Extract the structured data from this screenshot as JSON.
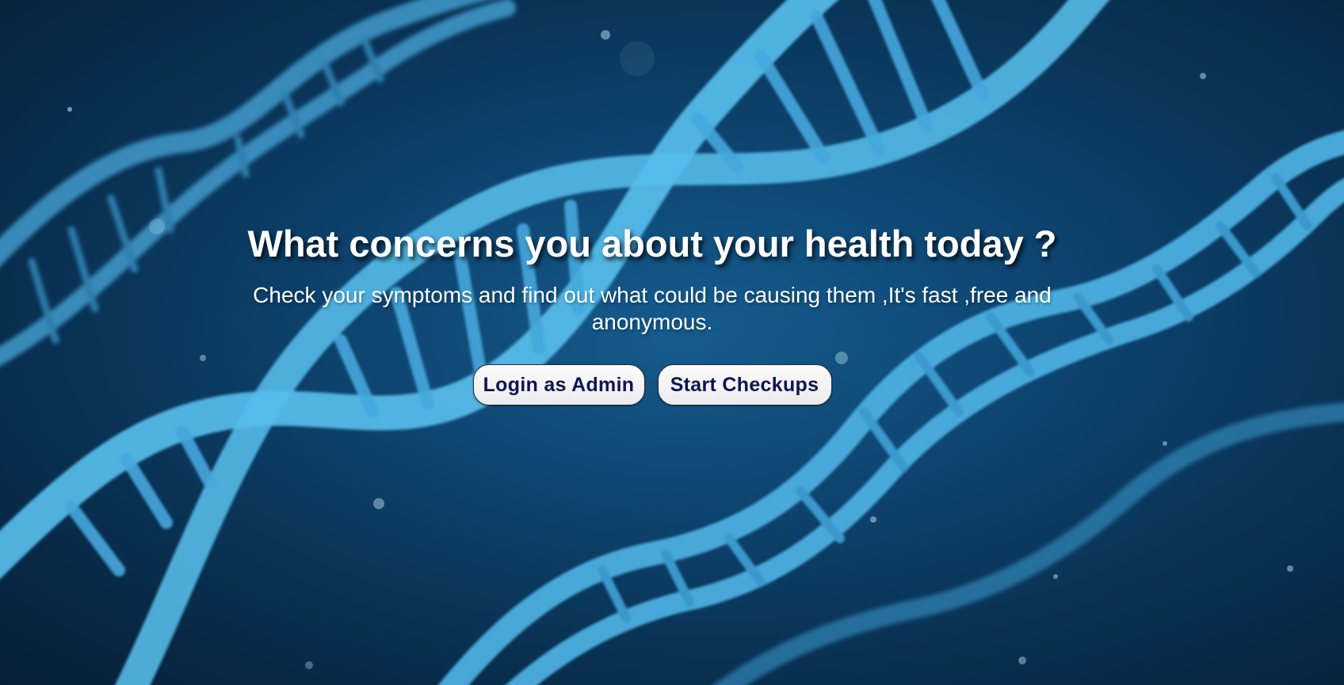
{
  "hero": {
    "headline": "What concerns you about your health today ?",
    "subtext": "Check your symptoms and find out what could be causing them ,It's fast ,free and anonymous.",
    "buttons": {
      "login_admin": "Login as Admin",
      "start_checkups": "Start Checkups"
    }
  },
  "background": {
    "subject": "dna-double-helix",
    "colors": {
      "base": "#0b3d66",
      "helix": "#4fb8e6",
      "rungs": "#3a9dd0"
    }
  },
  "colors": {
    "heading_text": "#ffffff",
    "button_text": "#0f1550",
    "button_bg": "#f3f3f6"
  }
}
